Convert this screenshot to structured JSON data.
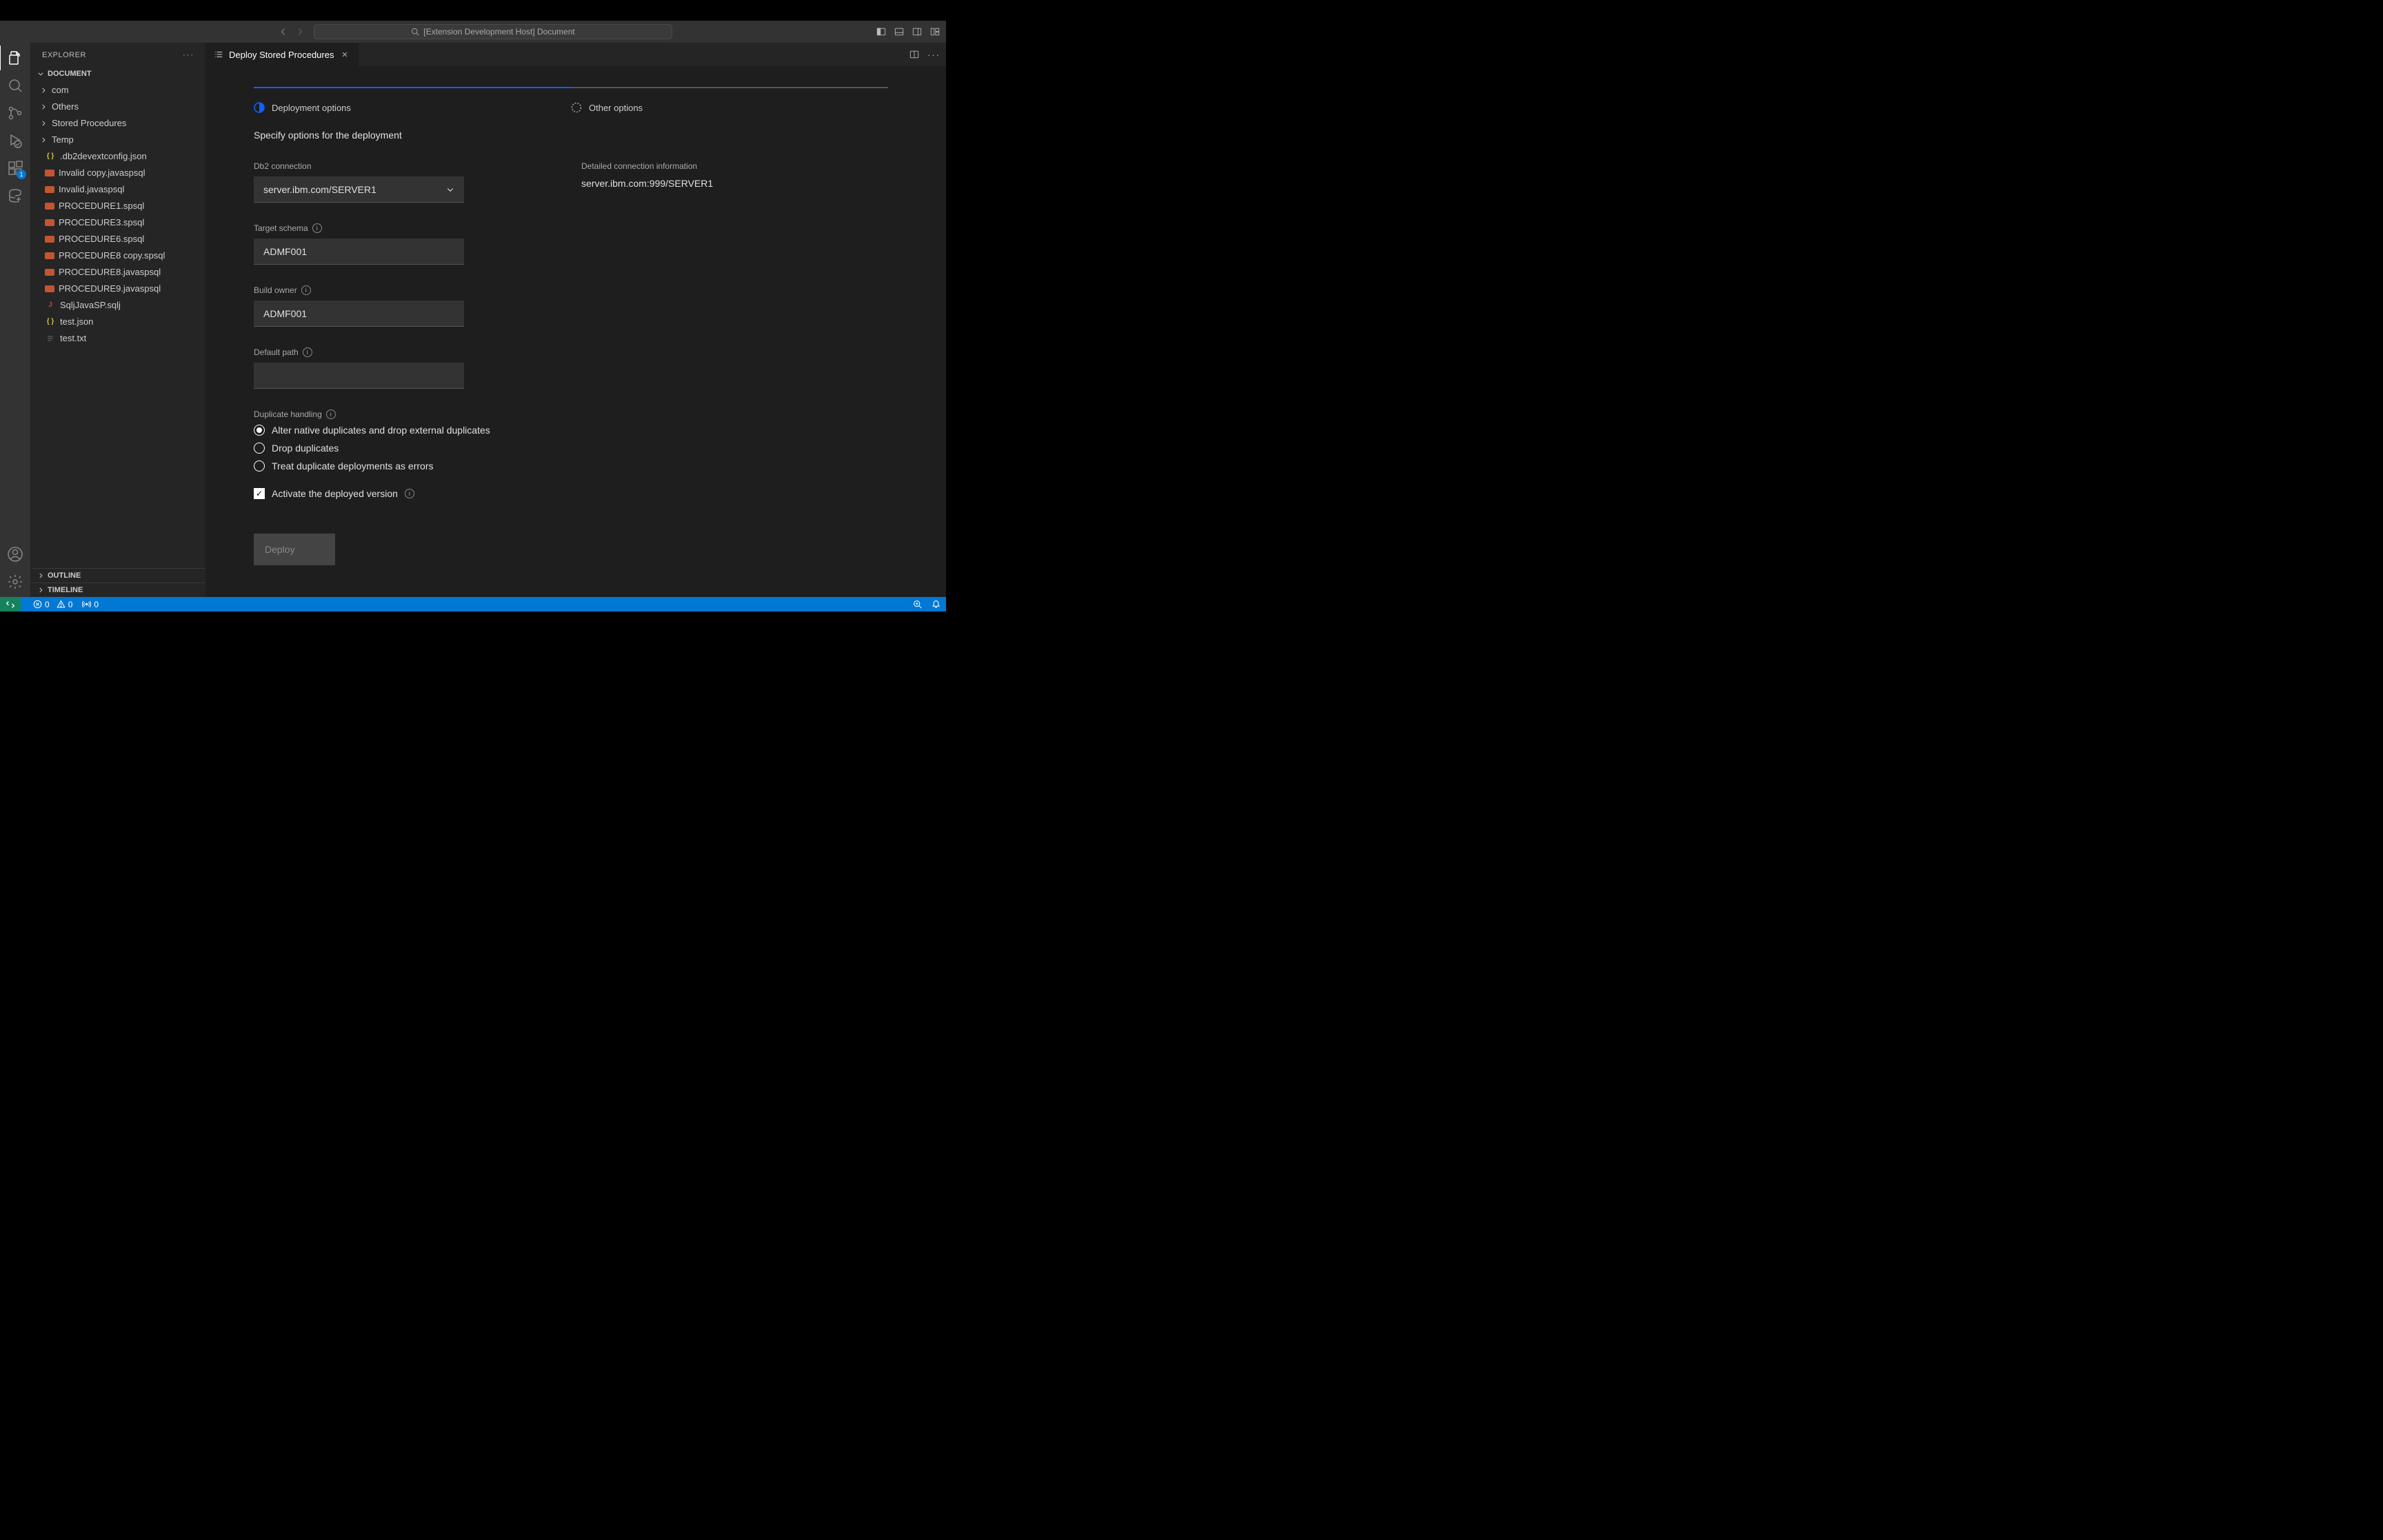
{
  "topbar": {
    "search_placeholder": "[Extension Development Host] Document"
  },
  "activity": {
    "ext_badge": "1"
  },
  "sidebar": {
    "title": "EXPLORER",
    "root": "DOCUMENT",
    "folders": [
      "com",
      "Others",
      "Stored Procedures",
      "Temp"
    ],
    "files": [
      {
        "name": ".db2devextconfig.json",
        "type": "json"
      },
      {
        "name": "Invalid copy.javaspsql",
        "type": "sql"
      },
      {
        "name": "Invalid.javaspsql",
        "type": "sql"
      },
      {
        "name": "PROCEDURE1.spsql",
        "type": "sql"
      },
      {
        "name": "PROCEDURE3.spsql",
        "type": "sql"
      },
      {
        "name": "PROCEDURE6.spsql",
        "type": "sql"
      },
      {
        "name": "PROCEDURE8 copy.spsql",
        "type": "sql"
      },
      {
        "name": "PROCEDURE8.javaspsql",
        "type": "sql"
      },
      {
        "name": "PROCEDURE9.javaspsql",
        "type": "sql"
      },
      {
        "name": "SqljJavaSP.sqlj",
        "type": "java"
      },
      {
        "name": "test.json",
        "type": "json"
      },
      {
        "name": "test.txt",
        "type": "txt"
      }
    ],
    "sections": {
      "outline": "OUTLINE",
      "timeline": "TIMELINE"
    }
  },
  "tab": {
    "title": "Deploy Stored Procedures"
  },
  "form": {
    "step1": "Deployment options",
    "step2": "Other options",
    "subtitle": "Specify options for the deployment",
    "db2_label": "Db2 connection",
    "db2_value": "server.ibm.com/SERVER1",
    "detail_label": "Detailed connection information",
    "detail_value": "server.ibm.com:999/SERVER1",
    "target_label": "Target schema",
    "target_value": "ADMF001",
    "owner_label": "Build owner",
    "owner_value": "ADMF001",
    "path_label": "Default path",
    "path_value": "",
    "dup_label": "Duplicate handling",
    "radio1": "Alter native duplicates and drop external duplicates",
    "radio2": "Drop duplicates",
    "radio3": "Treat duplicate deployments as errors",
    "activate": "Activate the deployed version",
    "deploy": "Deploy"
  },
  "status": {
    "errors": "0",
    "warnings": "0",
    "ports": "0"
  }
}
